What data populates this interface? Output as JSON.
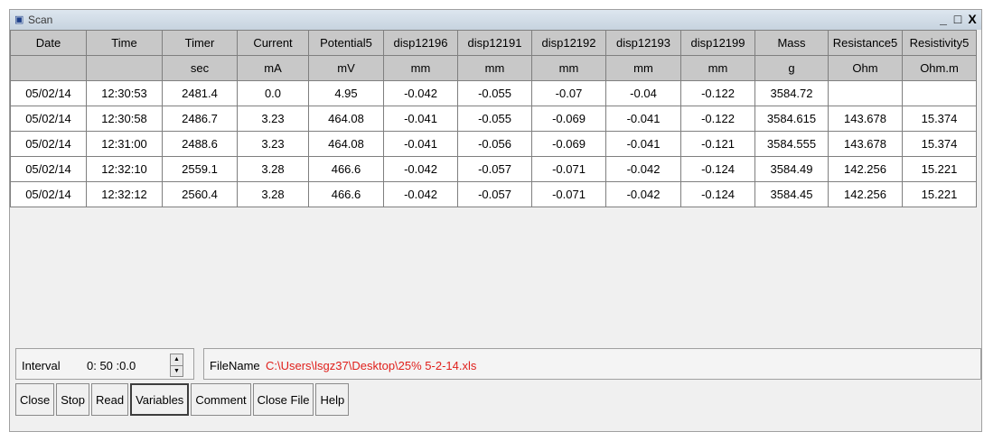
{
  "window": {
    "title": "Scan",
    "controls": [
      "_",
      "□",
      "X"
    ]
  },
  "grid": {
    "headers": [
      "Date",
      "Time",
      "Timer",
      "Current",
      "Potential5",
      "disp12196",
      "disp12191",
      "disp12192",
      "disp12193",
      "disp12199",
      "Mass",
      "Resistance5",
      "Resistivity5"
    ],
    "units": [
      "",
      "",
      "sec",
      "mA",
      "mV",
      "mm",
      "mm",
      "mm",
      "mm",
      "mm",
      "g",
      "Ohm",
      "Ohm.m"
    ],
    "rows": [
      [
        "05/02/14",
        "12:30:53",
        "2481.4",
        "0.0",
        "4.95",
        "-0.042",
        "-0.055",
        "-0.07",
        "-0.04",
        "-0.122",
        "3584.72",
        "",
        ""
      ],
      [
        "05/02/14",
        "12:30:58",
        "2486.7",
        "3.23",
        "464.08",
        "-0.041",
        "-0.055",
        "-0.069",
        "-0.041",
        "-0.122",
        "3584.615",
        "143.678",
        "15.374"
      ],
      [
        "05/02/14",
        "12:31:00",
        "2488.6",
        "3.23",
        "464.08",
        "-0.041",
        "-0.056",
        "-0.069",
        "-0.041",
        "-0.121",
        "3584.555",
        "143.678",
        "15.374"
      ],
      [
        "05/02/14",
        "12:32:10",
        "2559.1",
        "3.28",
        "466.6",
        "-0.042",
        "-0.057",
        "-0.071",
        "-0.042",
        "-0.124",
        "3584.49",
        "142.256",
        "15.221"
      ],
      [
        "05/02/14",
        "12:32:12",
        "2560.4",
        "3.28",
        "466.6",
        "-0.042",
        "-0.057",
        "-0.071",
        "-0.042",
        "-0.124",
        "3584.45",
        "142.256",
        "15.221"
      ]
    ]
  },
  "interval": {
    "label": "Interval",
    "value": "0: 50 :0.0"
  },
  "file": {
    "label": "FileName",
    "path": "C:\\Users\\lsgz37\\Desktop\\25% 5-2-14.xls",
    "path_color": "#e0201c"
  },
  "buttons": [
    {
      "label": "Close",
      "pressed": false
    },
    {
      "label": "Stop",
      "pressed": false
    },
    {
      "label": "Read",
      "pressed": false
    },
    {
      "label": "Variables",
      "pressed": true
    },
    {
      "label": "Comment",
      "pressed": false
    },
    {
      "label": "Close File",
      "pressed": false
    },
    {
      "label": "Help",
      "pressed": false
    }
  ]
}
